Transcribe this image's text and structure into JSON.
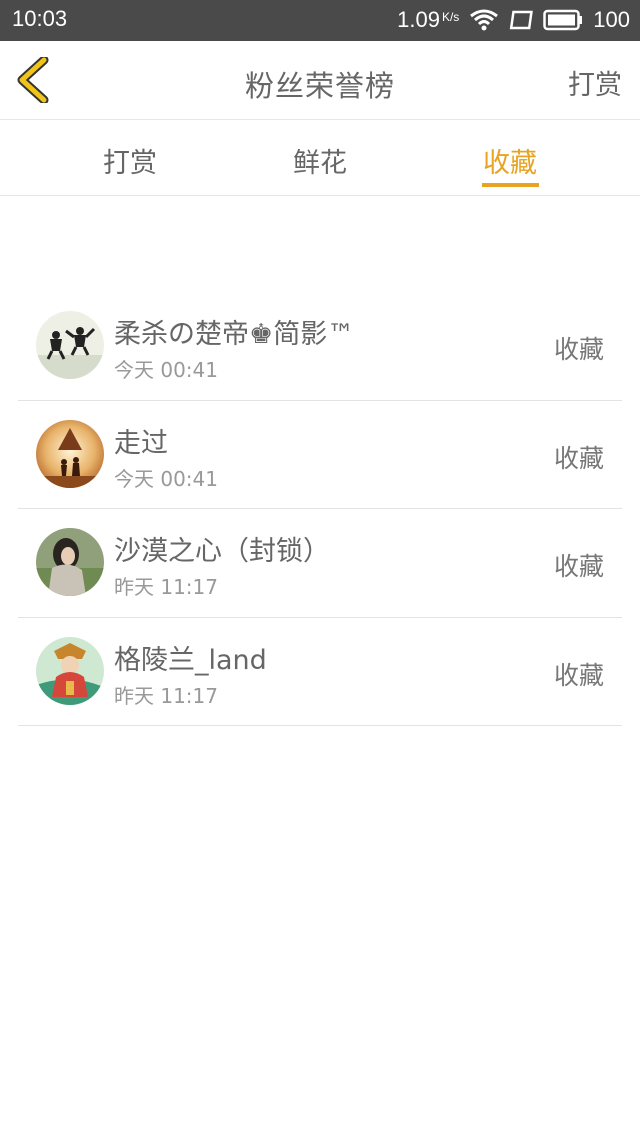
{
  "status_bar": {
    "time": "10:03",
    "speed": "1.09",
    "speed_unit": "K/s",
    "battery": "100"
  },
  "nav": {
    "title": "粉丝荣誉榜",
    "action_label": "打赏",
    "back_icon": "chevron-left-icon"
  },
  "tabs": [
    {
      "label": "打赏",
      "active": false
    },
    {
      "label": "鲜花",
      "active": false
    },
    {
      "label": "收藏",
      "active": true
    }
  ],
  "colors": {
    "accent": "#e8a420",
    "status_bar": "#4a4a4a",
    "back_icon": "#f0c419"
  },
  "list": [
    {
      "name": "柔杀の楚帝♚简影™",
      "time": "今天 00:41",
      "action": "收藏"
    },
    {
      "name": "走过",
      "time": "今天 00:41",
      "action": "收藏"
    },
    {
      "name": "沙漠之心（封锁）",
      "time": "昨天 11:17",
      "action": "收藏"
    },
    {
      "name": "格陵兰_land",
      "time": "昨天 11:17",
      "action": "收藏"
    }
  ]
}
